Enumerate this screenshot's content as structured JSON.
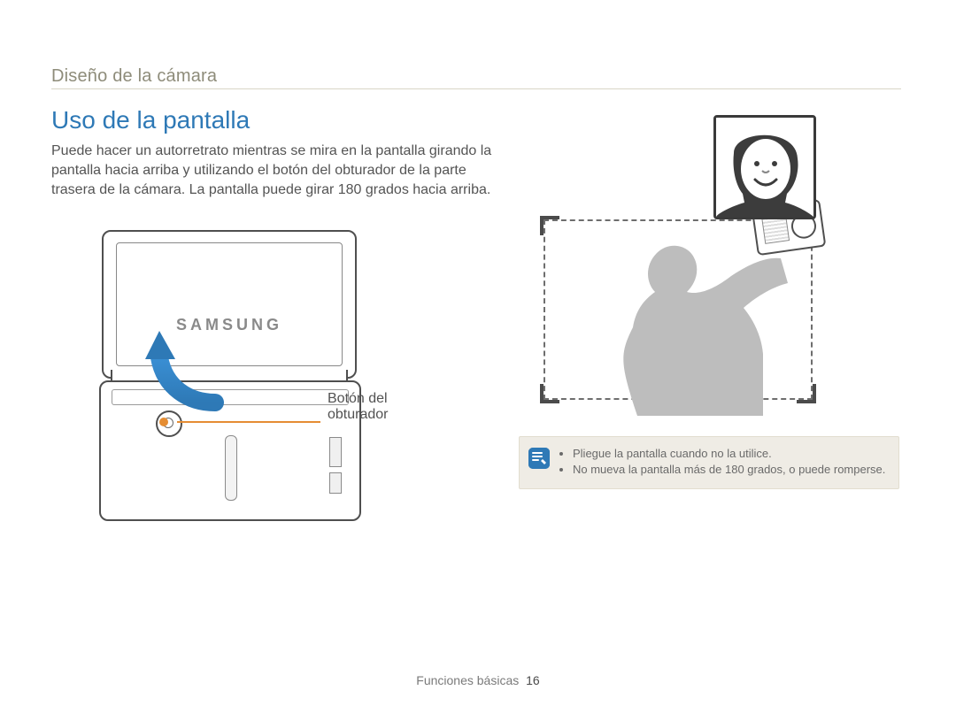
{
  "breadcrumb": "Diseño de la cámara",
  "title": "Uso de la pantalla",
  "body": "Puede hacer un autorretrato mientras se mira en la pantalla girando la pantalla hacia arriba y utilizando el botón del obturador de la parte trasera de la cámara. La pantalla puede girar 180 grados hacia arriba.",
  "brand": "SAMSUNG",
  "callout": {
    "shutter_label": "Botón del obturador"
  },
  "notes": {
    "items": [
      "Pliegue la pantalla cuando no la utilice.",
      "No mueva la pantalla más de 180 grados, o puede romperse."
    ]
  },
  "footer": {
    "section": "Funciones básicas",
    "page": "16"
  }
}
